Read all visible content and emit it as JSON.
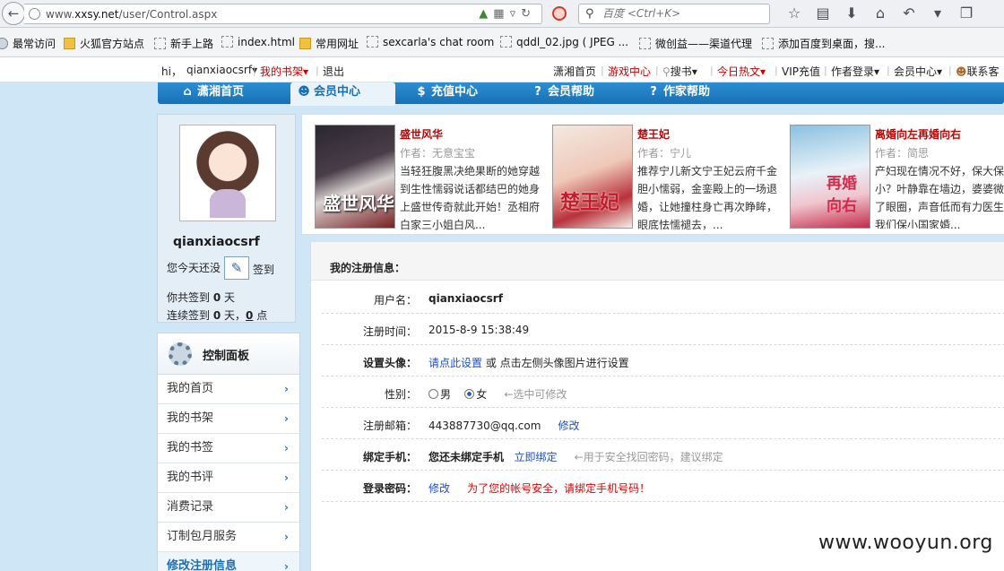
{
  "browser": {
    "url_prefix": "www.",
    "url_domain": "xxsy.net",
    "url_path": "/user/Control.aspx",
    "search_placeholder": "百度 <Ctrl+K>"
  },
  "bookmarks": [
    {
      "label": "最常访问",
      "type": "gear"
    },
    {
      "label": "火狐官方站点",
      "type": "folder"
    },
    {
      "label": "新手上路",
      "type": "page"
    },
    {
      "label": "index.html",
      "type": "page"
    },
    {
      "label": "常用网址",
      "type": "folder"
    },
    {
      "label": "sexcarla's chat room",
      "type": "page"
    },
    {
      "label": "qddl_02.jpg ( JPEG ...",
      "type": "page"
    },
    {
      "label": "微创益——渠道代理",
      "type": "page"
    },
    {
      "label": "添加百度到桌面，搜...",
      "type": "page"
    }
  ],
  "sitebar": {
    "greeting": "hi，",
    "user": "qianxiaocsrf",
    "bookshelf": "我的书架",
    "logout": "退出",
    "home": "潇湘首页",
    "games": "游戏中心",
    "search": "搜书",
    "hot": "今日热文",
    "vip": "VIP充值",
    "author_login": "作者登录",
    "member_center": "会员中心",
    "contact": "联系客"
  },
  "mainnav": {
    "home": "潇湘首页",
    "member": "会员中心",
    "recharge": "充值中心",
    "help": "会员帮助",
    "author_help": "作家帮助"
  },
  "profile": {
    "username": "qianxiaocsrf",
    "checkin_prompt": "您今天还没",
    "checkin_button": "签到",
    "total_prefix": "你共签到",
    "total_days": "0",
    "total_suffix": "天",
    "streak_prefix": "连续签到",
    "streak_days": "0",
    "streak_mid": "天，",
    "streak_points": "0",
    "streak_suffix": "点"
  },
  "panel": {
    "title": "控制面板",
    "items": [
      "我的首页",
      "我的书架",
      "我的书签",
      "我的书评",
      "消费记录",
      "订制包月服务",
      "修改注册信息"
    ]
  },
  "books": [
    {
      "title": "盛世风华",
      "author": "作者：无意宝宝",
      "desc": "当轻狂腹黑决绝果断的她穿越到生性懦弱说话都结巴的她身上盛世传奇就此开始！丞相府白家三小姐白风...",
      "cover_text": "盛世风华"
    },
    {
      "title": "楚王妃",
      "author": "作者：宁儿",
      "desc": "推荐宁儿新文宁王妃云府千金胆小懦弱，金銮殿上的一场退婚，让她撞柱身亡再次睁眸，眼底怯懦褪去，...",
      "cover_text": "楚王妃"
    },
    {
      "title": "离婚向左再婚向右",
      "author": "作者：简思",
      "desc": "产妇现在情况不好，保大保小？叶静靠在墙边，婆婆微红了眼圈，声音低而有力医生，我们保小国家婚...",
      "cover_text": "再婚向右"
    }
  ],
  "info": {
    "title": "我的注册信息：",
    "username_label": "用户名：",
    "username": "qianxiaocsrf",
    "regtime_label": "注册时间：",
    "regtime": "2015-8-9 15:38:49",
    "avatar_label": "设置头像：",
    "avatar_link": "请点此设置",
    "avatar_text": "或 点击左侧头像图片进行设置",
    "gender_label": "性别：",
    "male": "男",
    "female": "女",
    "gender_hint": "←选中可修改",
    "email_label": "注册邮箱：",
    "email": "443887730@qq.com",
    "email_edit": "修改",
    "phone_label": "绑定手机：",
    "phone_status": "您还未绑定手机",
    "phone_bind": "立即绑定",
    "phone_hint": "←用于安全找回密码，建议绑定",
    "password_label": "登录密码：",
    "password_edit": "修改",
    "password_warn": "为了您的帐号安全，请绑定手机号码！"
  },
  "watermark": "www.wooyun.org"
}
